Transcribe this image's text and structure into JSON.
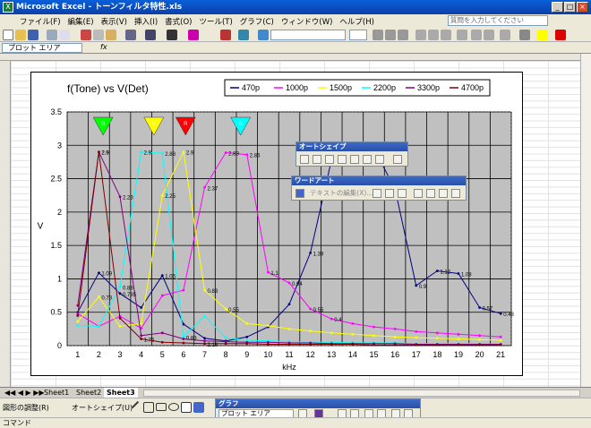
{
  "window": {
    "title": "Microsoft Excel - トーンフィルタ特性.xls",
    "app_icon": "X",
    "controls": [
      "_",
      "□",
      "×"
    ]
  },
  "menu": {
    "items": [
      "ファイル(F)",
      "編集(E)",
      "表示(V)",
      "挿入(I)",
      "書式(O)",
      "ツール(T)",
      "グラフ(C)",
      "ウィンドウ(W)",
      "ヘルプ(H)"
    ],
    "ask_placeholder": "質問を入力してください"
  },
  "formula": {
    "name_box": "プロット エリア",
    "fx": "fx"
  },
  "sheets": {
    "tabs": [
      "Sheet1",
      "Sheet2",
      "Sheet3"
    ],
    "active": "Sheet3"
  },
  "drawing_toolbar": {
    "draw_label": "図形の調整(R)",
    "autoshape_label": "オートシェイプ(U)"
  },
  "graph_toolbar": {
    "title": "グラフ",
    "selector": "プロット エリア"
  },
  "autoshape_palette": {
    "title": "オートシェイプ"
  },
  "wordart_palette": {
    "title": "ワードアート",
    "edit_label": "テキストの編集(X)..."
  },
  "status": {
    "text": "コマンド"
  },
  "colors": {
    "title_bar": "#0b4fc0",
    "plot_bg": "#c0c0c0",
    "s470": "#000080",
    "s1000": "#ff00ff",
    "s1500": "#ffff00",
    "s2200": "#00ffff",
    "s3300": "#800080",
    "s4700": "#800000"
  },
  "chart_data": {
    "type": "line",
    "title": "f(Tone) vs V(Det)",
    "xlabel": "kHz",
    "ylabel": "V",
    "ylim": [
      0,
      3.5
    ],
    "yticks": [
      "0",
      "0.5",
      "1",
      "1.5",
      "2",
      "2.5",
      "3",
      "3.5"
    ],
    "categories": [
      1,
      2,
      3,
      4,
      5,
      6,
      7,
      8,
      9,
      10,
      11,
      12,
      13,
      14,
      15,
      16,
      17,
      18,
      19,
      20,
      21
    ],
    "legend_position": "top",
    "series": [
      {
        "name": "470p",
        "color": "#000080",
        "values": [
          0.5,
          1.09,
          0.78,
          0.57,
          1.05,
          0.32,
          0.11,
          0.07,
          0.13,
          0.28,
          0.62,
          1.39,
          2.78,
          2.97,
          2.95,
          2.35,
          0.9,
          1.12,
          1.08,
          0.57,
          0.48
        ]
      },
      {
        "name": "1000p",
        "color": "#ff00ff",
        "values": [
          0.48,
          0.29,
          0.44,
          0.26,
          0.75,
          0.83,
          2.37,
          2.89,
          2.86,
          1.1,
          0.94,
          0.55,
          0.4,
          0.33,
          0.28,
          0.25,
          0.21,
          0.19,
          0.17,
          0.15,
          0.13
        ]
      },
      {
        "name": "1500p",
        "color": "#ffff00",
        "values": [
          0.36,
          0.73,
          0.29,
          0.33,
          2.25,
          2.9,
          0.83,
          0.55,
          0.33,
          0.3,
          0.25,
          0.22,
          0.19,
          0.17,
          0.15,
          0.13,
          0.12,
          0.11,
          0.1,
          0.09,
          0.08
        ]
      },
      {
        "name": "2200p",
        "color": "#00ffff",
        "values": [
          0.3,
          0.29,
          0.88,
          2.9,
          2.88,
          0.13,
          0.44,
          0.12,
          0.08,
          0.07,
          0.06,
          0.05,
          0.05,
          0.04,
          0.04,
          0.04,
          0.03,
          0.03,
          0.03,
          0.03,
          0.02
        ]
      },
      {
        "name": "3300p",
        "color": "#800080",
        "values": [
          0.6,
          2.9,
          2.23,
          0.15,
          0.19,
          0.1,
          0.07,
          0.06,
          0.05,
          0.05,
          0.04,
          0.04,
          0.03,
          0.03,
          0.03,
          0.03,
          0.02,
          0.02,
          0.02,
          0.02,
          0.02
        ]
      },
      {
        "name": "4700p",
        "color": "#800000",
        "values": [
          0.45,
          2.9,
          0.41,
          0.1,
          0.05,
          0.04,
          0.03,
          0.03,
          0.03,
          0.02,
          0.02,
          0.02,
          0.02,
          0.02,
          0.01,
          0.01,
          0.01,
          0.01,
          0.01,
          0.01,
          0.01
        ]
      }
    ],
    "point_labels": [
      {
        "series": "470p",
        "x": 2,
        "label": "1.09"
      },
      {
        "series": "470p",
        "x": 3,
        "label": "0.785"
      },
      {
        "series": "470p",
        "x": 5,
        "label": "1.05"
      },
      {
        "series": "470p",
        "x": 12,
        "label": "1.39"
      },
      {
        "series": "470p",
        "x": 17,
        "label": "0.9"
      },
      {
        "series": "470p",
        "x": 18,
        "label": "1.12"
      },
      {
        "series": "470p",
        "x": 19,
        "label": "1.08"
      },
      {
        "series": "470p",
        "x": 20,
        "label": "0.57"
      },
      {
        "series": "470p",
        "x": 21,
        "label": "0.48"
      },
      {
        "series": "1000p",
        "x": 7,
        "label": "2.37"
      },
      {
        "series": "1000p",
        "x": 8,
        "label": "2.89"
      },
      {
        "series": "1000p",
        "x": 9,
        "label": "2.86"
      },
      {
        "series": "1000p",
        "x": 10,
        "label": "1.1"
      },
      {
        "series": "1000p",
        "x": 11,
        "label": "0.94"
      },
      {
        "series": "1000p",
        "x": 12,
        "label": "0.55"
      },
      {
        "series": "1000p",
        "x": 13,
        "label": "0.4"
      },
      {
        "series": "1500p",
        "x": 2,
        "label": "0.73"
      },
      {
        "series": "1500p",
        "x": 5,
        "label": "2.25"
      },
      {
        "series": "1500p",
        "x": 6,
        "label": "2.9"
      },
      {
        "series": "1500p",
        "x": 7,
        "label": "0.83"
      },
      {
        "series": "1500p",
        "x": 8,
        "label": "0.55"
      },
      {
        "series": "2200p",
        "x": 3,
        "label": "0.88"
      },
      {
        "series": "2200p",
        "x": 4,
        "label": "2.9"
      },
      {
        "series": "2200p",
        "x": 5,
        "label": "2.88"
      },
      {
        "series": "2200p",
        "x": 6,
        "label": "0.83"
      },
      {
        "series": "3300p",
        "x": 2,
        "label": "2.9"
      },
      {
        "series": "3300p",
        "x": 3,
        "label": "2.23"
      },
      {
        "series": "4700p",
        "x": 2,
        "label": "2.9"
      },
      {
        "series": "4700p",
        "x": 4,
        "label": "1.75"
      },
      {
        "series": "4700p",
        "x": 7,
        "label": "2.18"
      }
    ],
    "markers": [
      {
        "x": 2.2,
        "label": "G",
        "color": "#00ff00"
      },
      {
        "x": 4.6,
        "label": "V",
        "color": "#ffff00"
      },
      {
        "x": 6.1,
        "label": "R",
        "color": "#ff0000"
      },
      {
        "x": 8.7,
        "label": "B",
        "color": "#00ffff"
      }
    ]
  }
}
